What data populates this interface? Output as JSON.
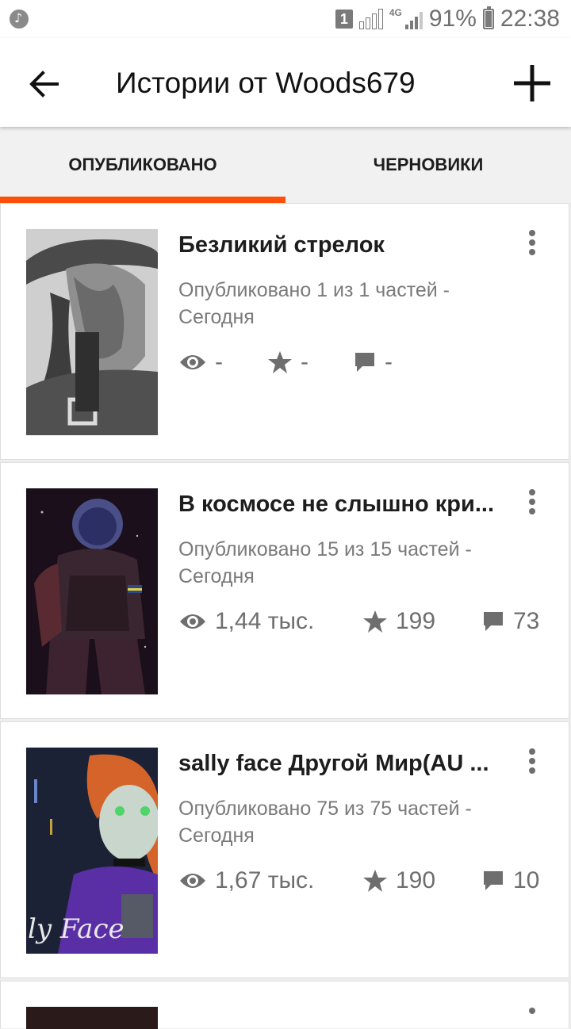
{
  "status_bar": {
    "sim": "1",
    "network": "4G",
    "battery": "91%",
    "battery_level": 0.91,
    "time": "22:38"
  },
  "app_bar": {
    "title": "Истории от Woods679",
    "back_icon": "arrow-left-icon",
    "add_icon": "plus-icon"
  },
  "tabs": [
    {
      "label": "ОПУБЛИКОВАНО",
      "active": true
    },
    {
      "label": "ЧЕРНОВИКИ",
      "active": false
    }
  ],
  "accent_color": "#ff500a",
  "stories": [
    {
      "title": "Безликий стрелок",
      "meta": "Опубликовано 1 из 1 частей - Сегодня",
      "views": "-",
      "votes": "-",
      "comments": "-"
    },
    {
      "title": "В космосе не слышно кри...",
      "meta": "Опубликовано 15 из 15 частей - Сегодня",
      "views": "1,44 тыс.",
      "votes": "199",
      "comments": "73"
    },
    {
      "title": "sally face Другой Мир(AU ...",
      "meta": "Опубликовано 75 из 75 частей - Сегодня",
      "views": "1,67 тыс.",
      "votes": "190",
      "comments": "10"
    }
  ]
}
